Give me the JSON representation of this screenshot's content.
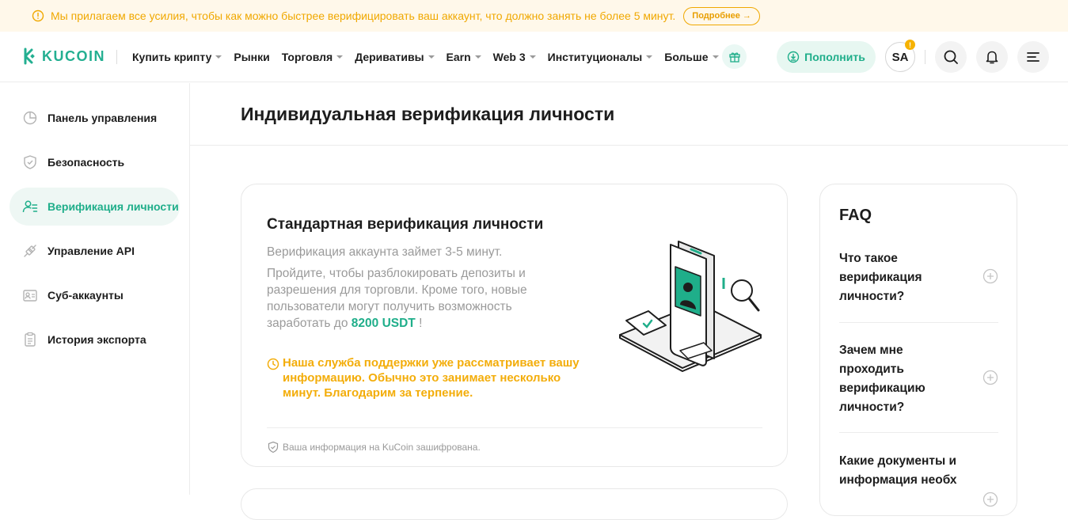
{
  "banner": {
    "text": "Мы прилагаем все усилия, чтобы как можно быстрее верифицировать ваш аккаунт, что должно занять не более 5 минут.",
    "more_label": "Подробнее →",
    "icon": "warning-circle-icon"
  },
  "header": {
    "logo_text": "KUCOIN",
    "nav": [
      {
        "label": "Купить крипту",
        "has_caret": true
      },
      {
        "label": "Рынки",
        "has_caret": false
      },
      {
        "label": "Торговля",
        "has_caret": true
      },
      {
        "label": "Деривативы",
        "has_caret": true
      },
      {
        "label": "Earn",
        "has_caret": true
      },
      {
        "label": "Web 3",
        "has_caret": true
      },
      {
        "label": "Институционалы",
        "has_caret": true
      },
      {
        "label": "Больше",
        "has_caret": true
      }
    ],
    "deposit_label": "Пополнить",
    "avatar_initials": "SA",
    "avatar_badge": "!",
    "accent": "#1fae8a"
  },
  "sidebar": {
    "items": [
      {
        "label": "Панель управления",
        "icon": "dashboard-icon",
        "active": false
      },
      {
        "label": "Безопасность",
        "icon": "shield-icon",
        "active": false
      },
      {
        "label": "Верификация личности",
        "icon": "user-verify-icon",
        "active": true
      },
      {
        "label": "Управление API",
        "icon": "api-icon",
        "active": false
      },
      {
        "label": "Суб-аккаунты",
        "icon": "sub-accounts-icon",
        "active": false
      },
      {
        "label": "История экспорта",
        "icon": "export-history-icon",
        "active": false
      }
    ]
  },
  "main": {
    "page_title": "Индивидуальная верификация личности",
    "card": {
      "title": "Стандартная верификация личности",
      "desc_line1": "Верификация аккаунта займет 3-5 минут.",
      "desc_main": "Пройдите, чтобы разблокировать депозиты и разрешения для торговли. Кроме того, новые пользователи могут получить возможность заработать до",
      "desc_amount": "8200 USDT",
      "desc_end": " !",
      "notice": "Наша служба поддержки уже рассматривает вашу информацию. Обычно это занимает несколько минут. Благодарим за терпение.",
      "secure_text": "Ваша информация на KuCoin зашифрована."
    }
  },
  "faq": {
    "title": "FAQ",
    "items": [
      {
        "question": "Что такое верификация личности?"
      },
      {
        "question": "Зачем мне проходить верификацию личности?"
      },
      {
        "question": "Какие документы и информация необх"
      }
    ]
  }
}
